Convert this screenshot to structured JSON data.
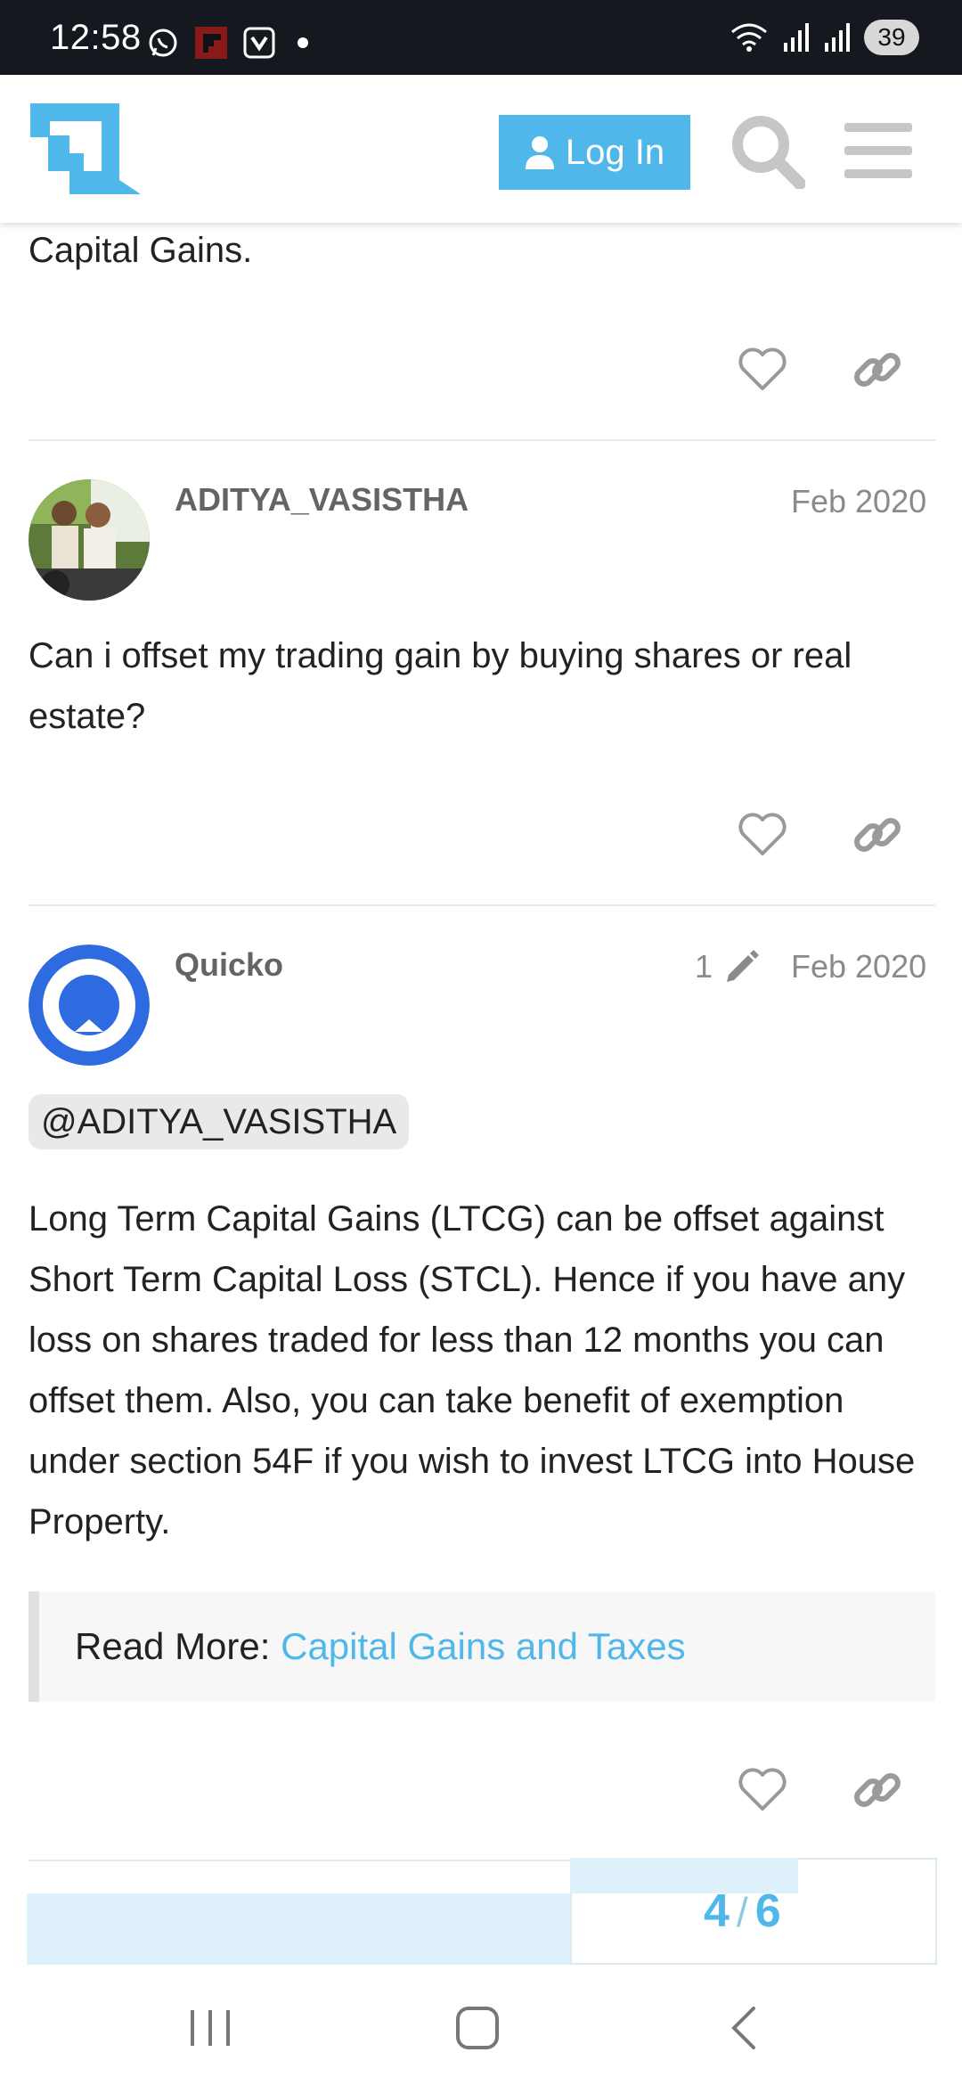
{
  "status_bar": {
    "time": "12:58",
    "left_icons": [
      "whatsapp-icon",
      "flipboard-icon",
      "app-notification-icon",
      "dot-icon"
    ],
    "right_icons": [
      "wifi-icon",
      "signal-icon",
      "signal-icon"
    ],
    "battery": "39"
  },
  "header": {
    "logo": "quicko-logo",
    "login_label": "Log In",
    "brand_color": "#4fb7e9"
  },
  "previous_post": {
    "text_tail": "Capital Gains."
  },
  "posts": [
    {
      "username": "ADITYA_VASISTHA",
      "date": "Feb 2020",
      "body": "Can i offset my trading gain by buying shares or real estate?"
    },
    {
      "username": "Quicko",
      "edit_count": "1",
      "date": "Feb 2020",
      "mention": "@ADITYA_VASISTHA",
      "body": "Long Term Capital Gains (LTCG) can be offset against Short Term Capital Loss (STCL). Hence if you have any loss on shares traded for less than 12 months you can offset them. Also, you can take benefit of exemption under section 54F if you wish to invest LTCG into House Property.",
      "read_more_label": "Read More: ",
      "read_more_link": "Capital Gains and Taxes"
    }
  ],
  "progress": {
    "current": "4",
    "separator": "/",
    "total": "6"
  },
  "nav_bar": {
    "buttons": [
      "recent-apps-icon",
      "home-icon",
      "back-icon"
    ]
  }
}
